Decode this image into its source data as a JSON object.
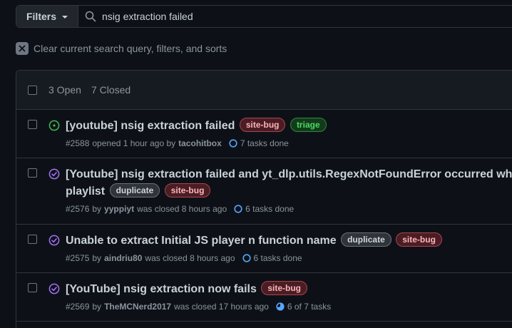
{
  "search": {
    "filters_label": "Filters",
    "query": "nsig extraction failed"
  },
  "clear": {
    "label": "Clear current search query, filters, and sorts"
  },
  "header": {
    "open_label": "3 Open",
    "closed_label": "7 Closed"
  },
  "issues": [
    {
      "state": "open",
      "title": "[youtube] nsig extraction failed",
      "labels": [
        "site-bug",
        "triage"
      ],
      "number": "#2588",
      "status_text": "opened 1 hour ago by",
      "author": "tacohitbox",
      "tasks": "7 tasks done"
    },
    {
      "state": "closed",
      "title_line1": "[Youtube] nsig extraction failed and yt_dlp.utils.RegexNotFoundError occurred when do",
      "title_line2": "playlist",
      "labels": [
        "duplicate",
        "site-bug"
      ],
      "number": "#2576",
      "by_text": "by",
      "author": "yyppiyt",
      "status_text": "was closed 8 hours ago",
      "tasks": "6 tasks done"
    },
    {
      "state": "closed",
      "title": "Unable to extract Initial JS player n function name",
      "labels": [
        "duplicate",
        "site-bug"
      ],
      "number": "#2575",
      "by_text": "by",
      "author": "aindriu80",
      "status_text": "was closed 8 hours ago",
      "tasks": "6 tasks done"
    },
    {
      "state": "closed",
      "title": "[YouTube] nsig extraction now fails",
      "labels": [
        "site-bug"
      ],
      "number": "#2569",
      "by_text": "by",
      "author": "TheMCNerd2017",
      "status_text": "was closed 17 hours ago",
      "tasks": "6 of 7 tasks"
    }
  ],
  "colors": {
    "background": "#0d1117",
    "open_icon": "#3fb950",
    "closed_icon": "#a371f7",
    "task_icon": "#58a6ff"
  },
  "icons": {
    "search": "search-icon",
    "clear": "x-icon",
    "open_issue": "issue-opened-icon",
    "closed_issue": "issue-closed-icon",
    "tasks": "progress-circle-icon"
  }
}
